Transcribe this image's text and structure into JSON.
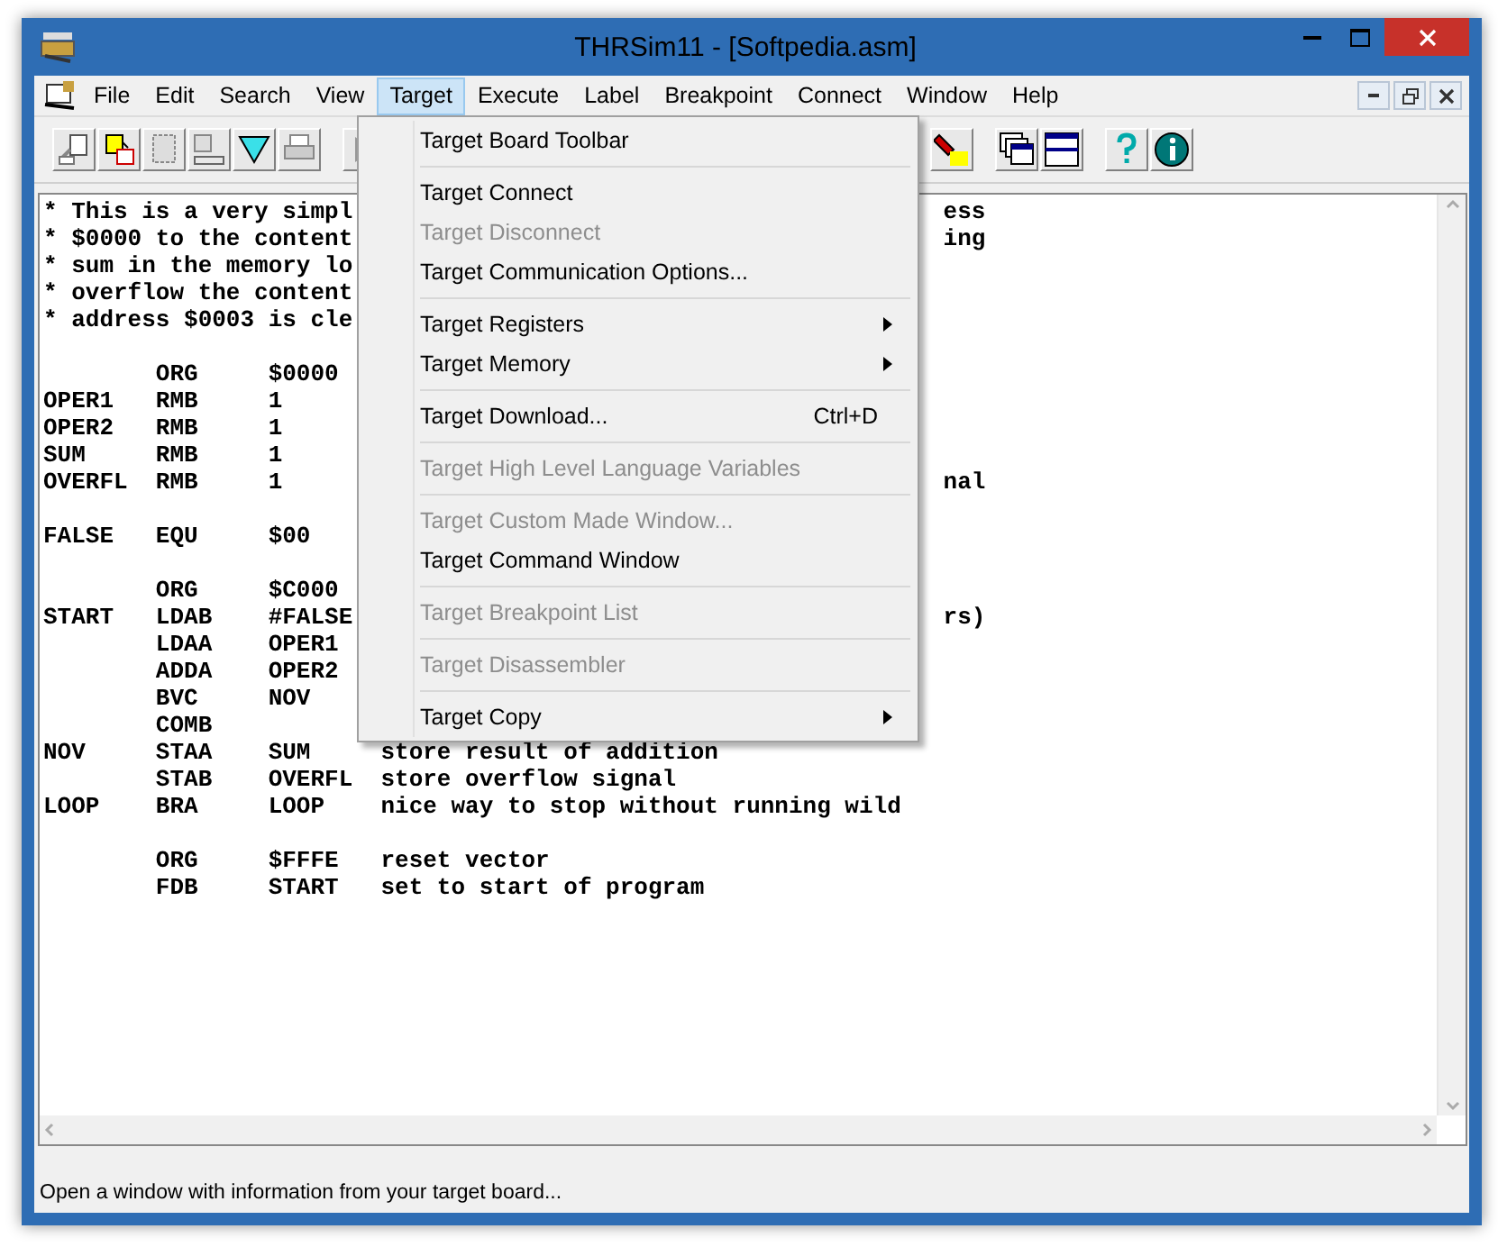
{
  "window": {
    "title": "THRSim11 - [Softpedia.asm]"
  },
  "menu_bar": [
    {
      "label": "File",
      "selected": false
    },
    {
      "label": "Edit",
      "selected": false
    },
    {
      "label": "Search",
      "selected": false
    },
    {
      "label": "View",
      "selected": false
    },
    {
      "label": "Target",
      "selected": true
    },
    {
      "label": "Execute",
      "selected": false
    },
    {
      "label": "Label",
      "selected": false
    },
    {
      "label": "Breakpoint",
      "selected": false
    },
    {
      "label": "Connect",
      "selected": false
    },
    {
      "label": "Window",
      "selected": false
    },
    {
      "label": "Help",
      "selected": false
    }
  ],
  "editor": {
    "lines": [
      {
        "kind": "code",
        "left": "* This is a very simpl",
        "right": "ess"
      },
      {
        "kind": "code",
        "left": "* $0000 to the content",
        "right": "ing"
      },
      {
        "kind": "code",
        "left": "* sum in the memory lo"
      },
      {
        "kind": "code",
        "left": "* overflow the content"
      },
      {
        "kind": "code",
        "left": "* address $0003 is cle"
      },
      {
        "kind": "blank"
      },
      {
        "kind": "code",
        "left": "        ORG     $0000"
      },
      {
        "kind": "code",
        "left": "OPER1   RMB     1"
      },
      {
        "kind": "code",
        "left": "OPER2   RMB     1"
      },
      {
        "kind": "code",
        "left": "SUM     RMB     1"
      },
      {
        "kind": "code",
        "left": "OVERFL  RMB     1",
        "right": "nal"
      },
      {
        "kind": "blank"
      },
      {
        "kind": "code",
        "left": "FALSE   EQU     $00"
      },
      {
        "kind": "blank"
      },
      {
        "kind": "code",
        "left": "        ORG     $C000"
      },
      {
        "kind": "code",
        "left": "START   LDAB    #FALSE",
        "right": "rs)"
      },
      {
        "kind": "code",
        "left": "        LDAA    OPER1"
      },
      {
        "kind": "code",
        "left": "        ADDA    OPER2"
      },
      {
        "kind": "code",
        "left": "        BVC     NOV"
      },
      {
        "kind": "code",
        "left": "        COMB"
      },
      {
        "kind": "code",
        "left": "NOV     STAA    SUM     store result of addition"
      },
      {
        "kind": "code",
        "left": "        STAB    OVERFL  store overflow signal"
      },
      {
        "kind": "code",
        "left": "LOOP    BRA     LOOP    nice way to stop without running wild"
      },
      {
        "kind": "blank"
      },
      {
        "kind": "code",
        "left": "        ORG     $FFFE   reset vector"
      },
      {
        "kind": "code",
        "left": "        FDB     START   set to start of program"
      }
    ]
  },
  "dropdown_menu": [
    {
      "kind": "item",
      "label": "Target Board Toolbar",
      "disabled": false,
      "submenu": false
    },
    {
      "kind": "separator"
    },
    {
      "kind": "item",
      "label": "Target Connect",
      "disabled": false,
      "submenu": false
    },
    {
      "kind": "item",
      "label": "Target Disconnect",
      "disabled": true,
      "submenu": false
    },
    {
      "kind": "item",
      "label": "Target Communication Options...",
      "disabled": false,
      "submenu": false
    },
    {
      "kind": "separator"
    },
    {
      "kind": "item",
      "label": "Target Registers",
      "disabled": false,
      "submenu": true
    },
    {
      "kind": "item",
      "label": "Target Memory",
      "disabled": false,
      "submenu": true
    },
    {
      "kind": "separator"
    },
    {
      "kind": "item",
      "label": "Target Download...",
      "shortcut": "Ctrl+D",
      "disabled": false,
      "submenu": false
    },
    {
      "kind": "separator"
    },
    {
      "kind": "item",
      "label": "Target High Level Language Variables",
      "disabled": true,
      "submenu": false
    },
    {
      "kind": "separator"
    },
    {
      "kind": "item",
      "label": "Target Custom Made Window...",
      "disabled": true,
      "submenu": false
    },
    {
      "kind": "item",
      "label": "Target Command Window",
      "disabled": false,
      "submenu": false
    },
    {
      "kind": "separator"
    },
    {
      "kind": "item",
      "label": "Target Breakpoint List",
      "disabled": true,
      "submenu": false
    },
    {
      "kind": "separator"
    },
    {
      "kind": "item",
      "label": "Target Disassembler",
      "disabled": true,
      "submenu": false
    },
    {
      "kind": "separator"
    },
    {
      "kind": "item",
      "label": "Target Copy",
      "disabled": false,
      "submenu": true
    }
  ],
  "status_bar": {
    "text": "Open a window with information from your target board..."
  }
}
